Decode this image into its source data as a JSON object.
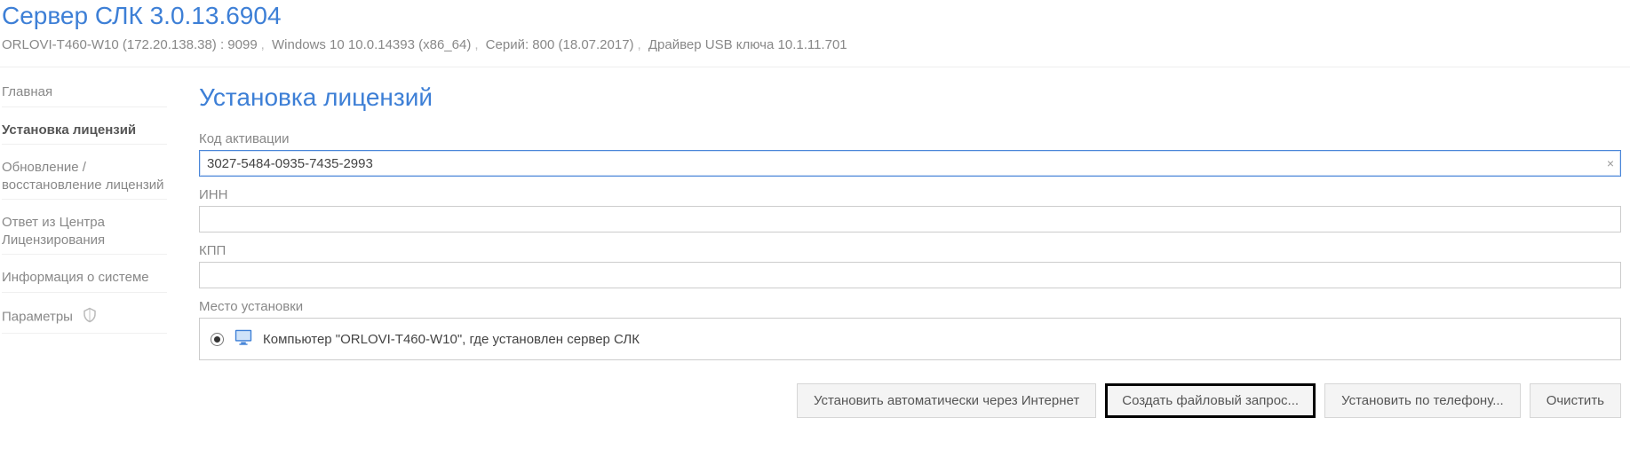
{
  "header": {
    "title": "Сервер СЛК 3.0.13.6904",
    "host": "ORLOVI-T460-W10 (172.20.138.38) : 9099",
    "os": "Windows 10 10.0.14393 (x86_64)",
    "series": "Серий: 800 (18.07.2017)",
    "driver": "Драйвер USB ключа 10.1.11.701"
  },
  "sidebar": {
    "items": [
      {
        "label": "Главная"
      },
      {
        "label": "Установка лицензий",
        "active": true
      },
      {
        "label": "Обновление / восстановление лицензий"
      },
      {
        "label": "Ответ из Центра Лицензирования"
      },
      {
        "label": "Информация о системе"
      },
      {
        "label": "Параметры",
        "icon": "shield"
      }
    ]
  },
  "main": {
    "title": "Установка лицензий",
    "fields": {
      "activation_label": "Код активации",
      "activation_value": "3027-5484-0935-7435-2993",
      "inn_label": "ИНН",
      "inn_value": "",
      "kpp_label": "КПП",
      "kpp_value": "",
      "install_place_label": "Место установки",
      "install_place_option": "Компьютер \"ORLOVI-T460-W10\", где установлен сервер СЛК"
    },
    "buttons": {
      "auto_internet": "Установить автоматически через Интернет",
      "create_file_request": "Создать файловый запрос...",
      "install_by_phone": "Установить по телефону...",
      "clear": "Очистить"
    }
  }
}
